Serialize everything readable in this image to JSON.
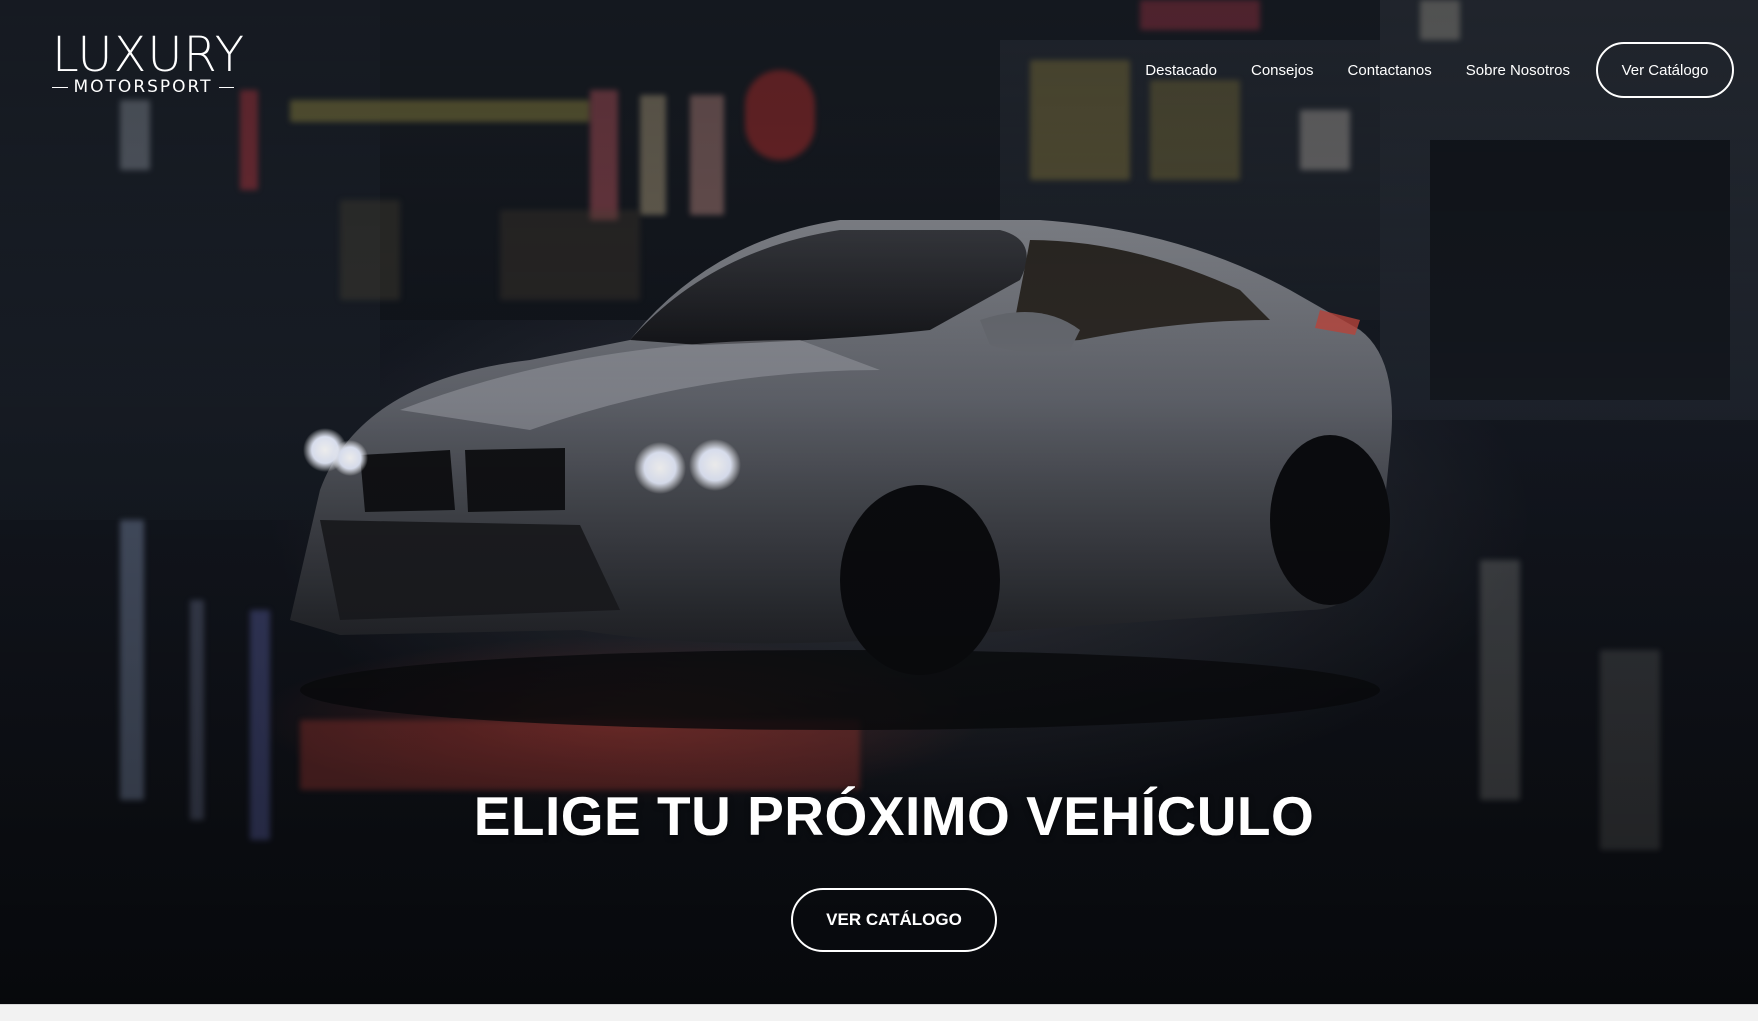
{
  "logo": {
    "main": "LUXURY",
    "sub": "MOTORSPORT"
  },
  "nav": {
    "links": [
      "Destacado",
      "Consejos",
      "Contactanos",
      "Sobre Nosotros"
    ],
    "cta_label": "Ver Catálogo"
  },
  "hero": {
    "title": "ELIGE TU PRÓXIMO VEHÍCULO",
    "button_label": "VER CATÁLOGO",
    "background_image": "night-street-drifting-car"
  },
  "colors": {
    "text": "#ffffff",
    "background_dark": "#10131a",
    "accent_red": "#d2463c"
  }
}
